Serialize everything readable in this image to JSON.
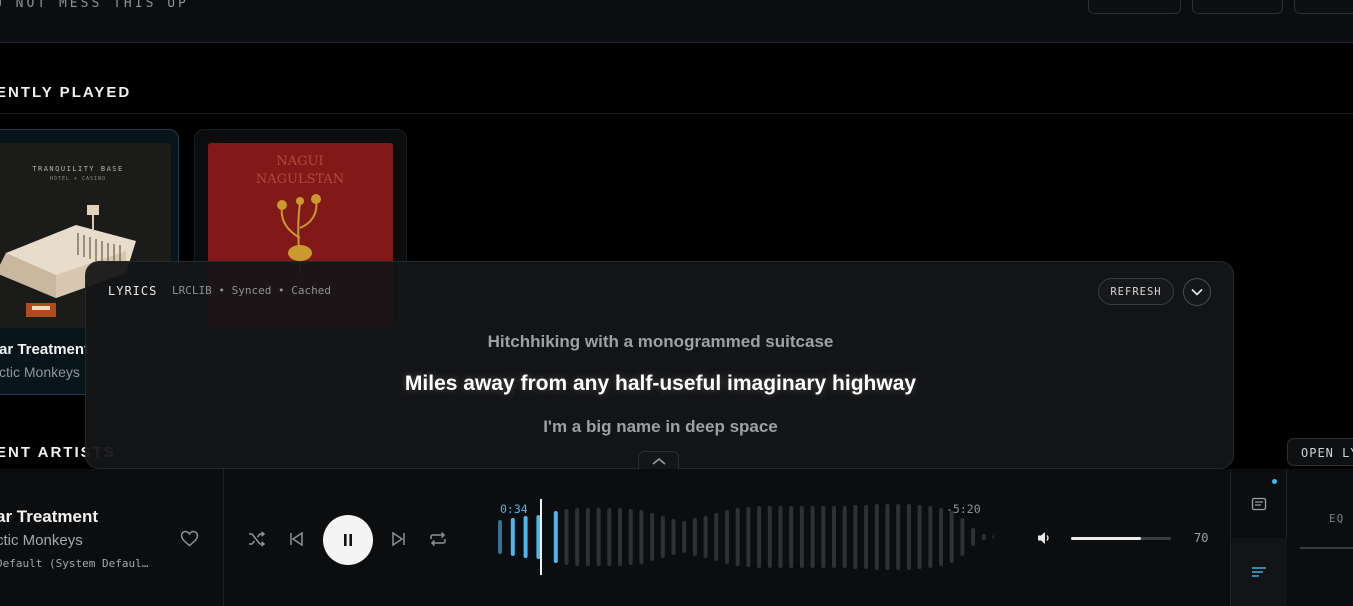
{
  "header": {
    "title": "U NOT MESS THIS UP"
  },
  "sections": {
    "recently_played": "ENTLY PLAYED",
    "recent_artists": "ENT ARTISTS"
  },
  "albums": [
    {
      "title": "ar Treatment",
      "artist": "ctic Monkeys",
      "cover_text_1": "TRANQUILITY BASE",
      "cover_text_2": "HOTEL + CASINO"
    },
    {
      "title": "",
      "artist": "",
      "cover_text_1": "NAGUI",
      "cover_text_2": "NAGULSTAN"
    }
  ],
  "lyrics": {
    "label": "LYRICS",
    "source": "LRCLIB • Synced • Cached",
    "refresh_label": "REFRESH",
    "prev_line": "Hitchhiking with a monogrammed suitcase",
    "current_line": "Miles away from any half-useful imaginary highway",
    "next_line": "I'm a big name in deep space",
    "open_label": "OPEN LYRICS"
  },
  "player": {
    "title": "ar Treatment",
    "artist": "ctic Monkeys",
    "device": "Default (System Defaul…",
    "elapsed": "0:34",
    "remaining": "-5:20",
    "progress_fraction": 0.095,
    "volume": "70",
    "volume_fraction": 0.7,
    "eq_label": "EQ",
    "accent": "#4cb6ee"
  },
  "icons": {
    "shuffle": "shuffle-icon",
    "prev": "skip-back-icon",
    "pause": "pause-icon",
    "next": "skip-forward-icon",
    "repeat": "repeat-icon",
    "heart": "heart-icon",
    "volume": "volume-icon",
    "queue": "queue-icon",
    "lyrics": "lyrics-icon"
  }
}
